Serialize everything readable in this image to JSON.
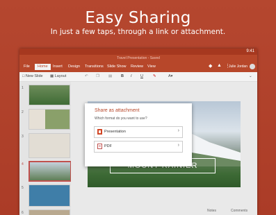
{
  "promo": {
    "title": "Easy Sharing",
    "subtitle": "In just a few taps, through a link or attachment."
  },
  "status": {
    "time": "9:41"
  },
  "window": {
    "title": "Travel Presentation - Saved"
  },
  "tabs": [
    "File",
    "Home",
    "Insert",
    "Design",
    "Transitions",
    "Slide Show",
    "Review",
    "View"
  ],
  "active_tab": "Home",
  "user": "Julie Jordan",
  "ribbon": {
    "new_slide": "New Slide",
    "layout": "Layout"
  },
  "slide_numbers": [
    "1",
    "2",
    "3",
    "4",
    "5",
    "6"
  ],
  "slide": {
    "title": "MOUNT RAINIER"
  },
  "bottom": {
    "notes": "Notes",
    "comments": "Comments"
  },
  "dialog": {
    "title": "Share as attachment",
    "question": "Which format do you want to use?",
    "options": [
      {
        "label": "Presentation"
      },
      {
        "label": "PDF"
      }
    ]
  },
  "colors": {
    "accent": "#b7472a",
    "background": "#b5452f"
  }
}
